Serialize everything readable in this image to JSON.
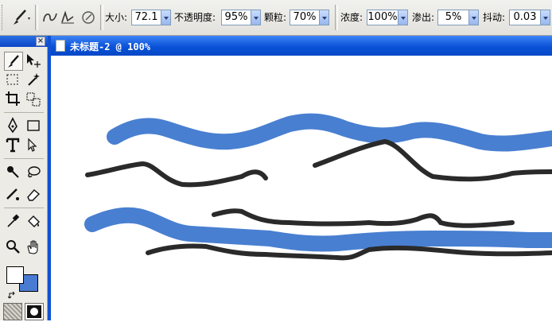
{
  "options": {
    "size_label": "大小:",
    "size_value": "72.1",
    "opacity_label": "不透明度:",
    "opacity_value": "95%",
    "grain_label": "颗粒:",
    "grain_value": "70%",
    "saturation_label": "浓度:",
    "saturation_value": "100%",
    "bleed_label": "渗出:",
    "bleed_value": "5%",
    "jitter_label": "抖动:",
    "jitter_value": "0.03"
  },
  "document": {
    "title": "未标题-2 @ 100%"
  },
  "colors": {
    "foreground": "#ffffff",
    "background": "#4a7bd2",
    "stroke_blue": "#3e78cf",
    "stroke_dark": "#2a2a2a"
  },
  "icons": {
    "active_tool": "brush-icon",
    "brush_presets": [
      "brush-preset-1-icon",
      "brush-preset-2-icon",
      "brush-preset-3-icon"
    ]
  }
}
